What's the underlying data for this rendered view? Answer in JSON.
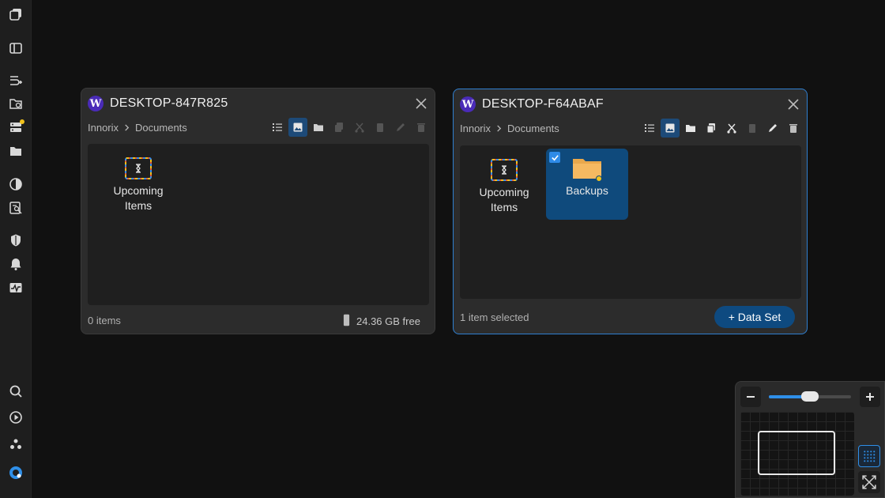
{
  "sidebar": {
    "items": [
      {
        "icon": "windows-icon"
      },
      {
        "icon": "sidebar-panel-icon"
      },
      {
        "icon": "add-route-icon"
      },
      {
        "icon": "folder-sync-icon"
      },
      {
        "icon": "server-icon",
        "badge": true
      },
      {
        "icon": "folder-icon"
      },
      {
        "icon": "pie-chart-icon"
      },
      {
        "icon": "report-search-icon"
      },
      {
        "icon": "shield-icon"
      },
      {
        "icon": "bell-icon"
      },
      {
        "icon": "activity-icon"
      },
      {
        "icon": "search-icon"
      },
      {
        "icon": "play-circle-icon"
      },
      {
        "icon": "community-icon"
      },
      {
        "icon": "app-logo-icon"
      }
    ]
  },
  "windows": [
    {
      "title": "DESKTOP-847R825",
      "logo_letter": "W",
      "breadcrumb": [
        "Innorix",
        "Documents"
      ],
      "files": [
        {
          "label_line1": "Upcoming",
          "label_line2": "Items",
          "type": "upcoming"
        }
      ],
      "status": "0 items",
      "free_space": "24.36 GB free"
    },
    {
      "title": "DESKTOP-F64ABAF",
      "logo_letter": "W",
      "breadcrumb": [
        "Innorix",
        "Documents"
      ],
      "files": [
        {
          "label_line1": "Upcoming",
          "label_line2": "Items",
          "type": "upcoming"
        },
        {
          "label_line1": "Backups",
          "label_line2": "",
          "type": "folder",
          "selected": true
        }
      ],
      "status": "1 item selected",
      "action_button": "+ Data Set"
    }
  ],
  "zoom": {
    "level": 0.5
  },
  "colors": {
    "accent": "#2f8fe8",
    "selection": "#0f4a7c",
    "folder": "#f5b961",
    "badge": "#f2c21b",
    "logo": "#4a2bb8"
  }
}
